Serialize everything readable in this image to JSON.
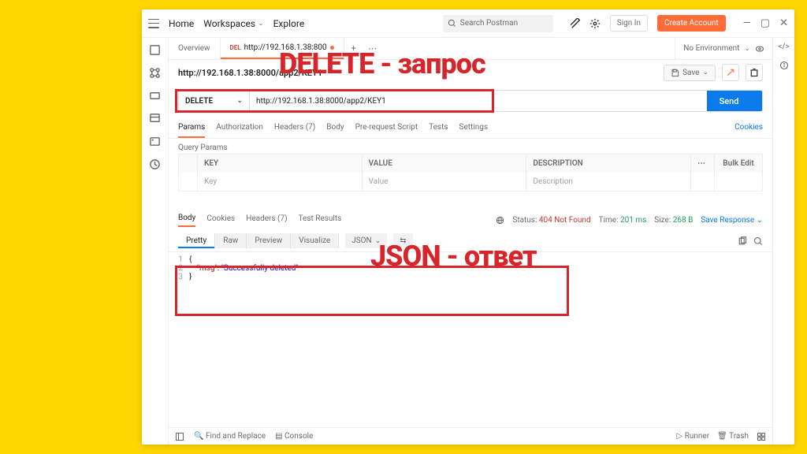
{
  "top": {
    "home": "Home",
    "workspaces": "Workspaces",
    "explore": "Explore",
    "search_placeholder": "Search Postman",
    "signin": "Sign In",
    "create": "Create Account"
  },
  "tabs": {
    "overview": "Overview",
    "method_short": "DEL",
    "url_short": "http://192.168.1.38:800",
    "env": "No Environment"
  },
  "title": "http://192.168.1.38:8000/app2/KEY1",
  "save": "Save",
  "request": {
    "method": "DELETE",
    "url": "http://192.168.1.38:8000/app2/KEY1",
    "send": "Send"
  },
  "reqtabs": {
    "params": "Params",
    "auth": "Authorization",
    "headers": "Headers (7)",
    "body": "Body",
    "prereq": "Pre-request Script",
    "tests": "Tests",
    "settings": "Settings",
    "cookies": "Cookies"
  },
  "qp_label": "Query Params",
  "table": {
    "key": "KEY",
    "value": "VALUE",
    "desc": "DESCRIPTION",
    "bulk": "Bulk Edit",
    "ph_key": "Key",
    "ph_value": "Value",
    "ph_desc": "Description"
  },
  "resp": {
    "body": "Body",
    "cookies": "Cookies",
    "headers": "Headers (7)",
    "tests": "Test Results",
    "status_label": "Status:",
    "status_code": "404 Not Found",
    "time_label": "Time:",
    "time_val": "201 ms",
    "size_label": "Size:",
    "size_val": "268 B",
    "save": "Save Response"
  },
  "view": {
    "pretty": "Pretty",
    "raw": "Raw",
    "preview": "Preview",
    "visualize": "Visualize",
    "format": "JSON"
  },
  "json": {
    "key": "\"msg\"",
    "val": "\"Successfully deleted\""
  },
  "status": {
    "find": "Find and Replace",
    "console": "Console",
    "runner": "Runner",
    "trash": "Trash"
  },
  "annot1": "DELETE - запрос",
  "annot2": "JSON - ответ"
}
